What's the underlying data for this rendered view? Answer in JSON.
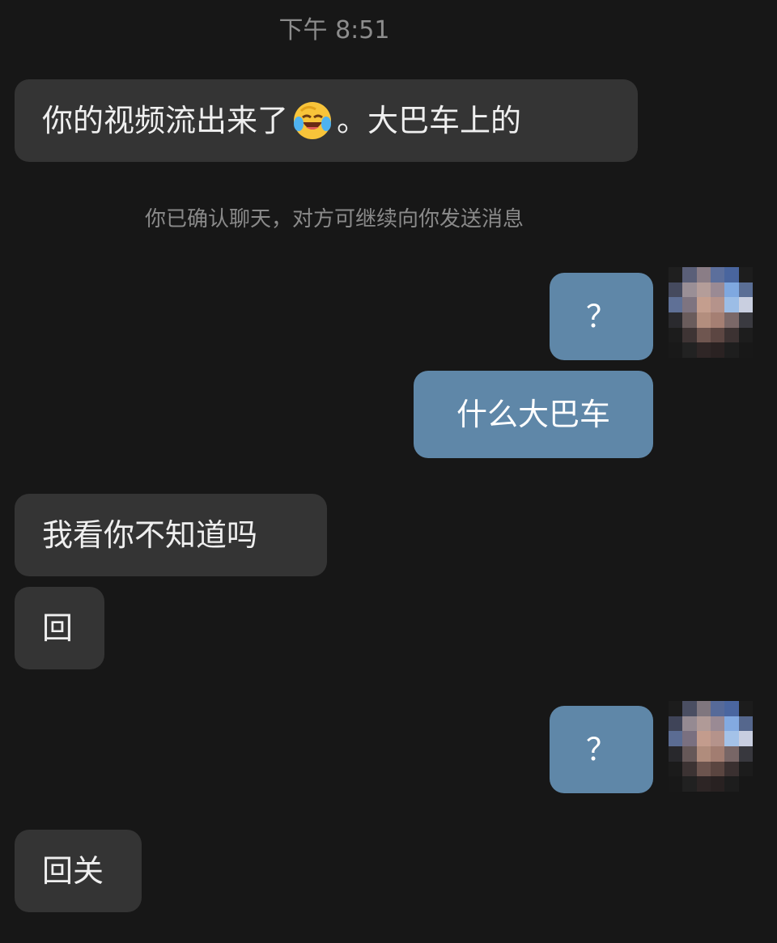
{
  "timestamp": "下午 8:51",
  "system_notice": "你已确认聊天，对方可继续向你发送消息",
  "messages": [
    {
      "side": "in",
      "text_before": "你的视频流出来了",
      "emoji": "tears-of-joy-emoji",
      "text_after": "。大巴车上的"
    },
    {
      "side": "out",
      "text": "？"
    },
    {
      "side": "out",
      "text": "什么大巴车"
    },
    {
      "side": "in",
      "text": "我看你不知道吗"
    },
    {
      "side": "in",
      "text": "回"
    },
    {
      "side": "out",
      "text": "？"
    },
    {
      "side": "in",
      "text": "回关"
    }
  ],
  "colors": {
    "background": "#171717",
    "incoming_bubble": "#343434",
    "outgoing_bubble": "#5f87a8",
    "muted_text": "#8a8a8a"
  },
  "avatar": {
    "icon": "pixelated-user-avatar-icon"
  }
}
